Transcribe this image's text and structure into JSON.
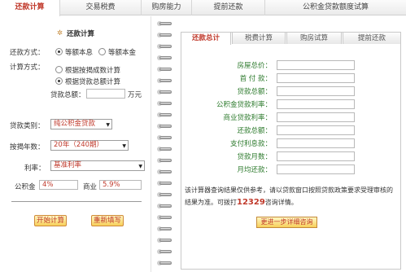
{
  "top_tabs": {
    "repay_calc": "还款计算",
    "tax": "交易税费",
    "afford": "购房能力",
    "prepay": "提前还款",
    "fund_quota": "公积金贷款额度试算"
  },
  "left": {
    "title": "还款计算",
    "repay_mode_label": "还款方式：",
    "opt_equal_interest": "等额本息",
    "opt_equal_principal": "等额本金",
    "calc_mode_label": "计算方式：",
    "opt_by_mortgage": "根据按揭成数计算",
    "opt_by_total": "根据贷款总额计算",
    "loan_total_label": "贷款总额：",
    "loan_total_unit": "万元",
    "loan_type_label": "贷款类别：",
    "loan_type_value": "纯公积金贷款",
    "years_label": "按揭年数：",
    "years_value": "20年（240期）",
    "rate_label": "利率：",
    "rate_value": "基准利率",
    "fund_label": "公积金",
    "fund_rate": "4%",
    "biz_label": "商业",
    "biz_rate": "5.9%",
    "start_button": "开始计算",
    "reset_button": "重新填写"
  },
  "right": {
    "subtabs": {
      "summary": "还款总计",
      "tax": "税费计算",
      "buy": "购房试算",
      "prepay": "提前还款"
    },
    "rows": [
      "房屋总价：",
      "首 付 款：",
      "贷款总额：",
      "公积金贷款利率：",
      "商业贷款利率：",
      "还款总额：",
      "支付利息款：",
      "贷款月数：",
      "月均还款："
    ],
    "note_text": "该计算器查询结果仅供参考，请以贷款窗口按照贷款政策要求受理审核的结果为准。可拨打",
    "hotline": "12329",
    "note_suffix": "咨询详情。",
    "consult_button": "更进一步详细咨询"
  },
  "colors": {
    "accent_red": "#c0392b",
    "label_green": "#2c7a2c",
    "button_yellow": "#f7cf5a"
  }
}
